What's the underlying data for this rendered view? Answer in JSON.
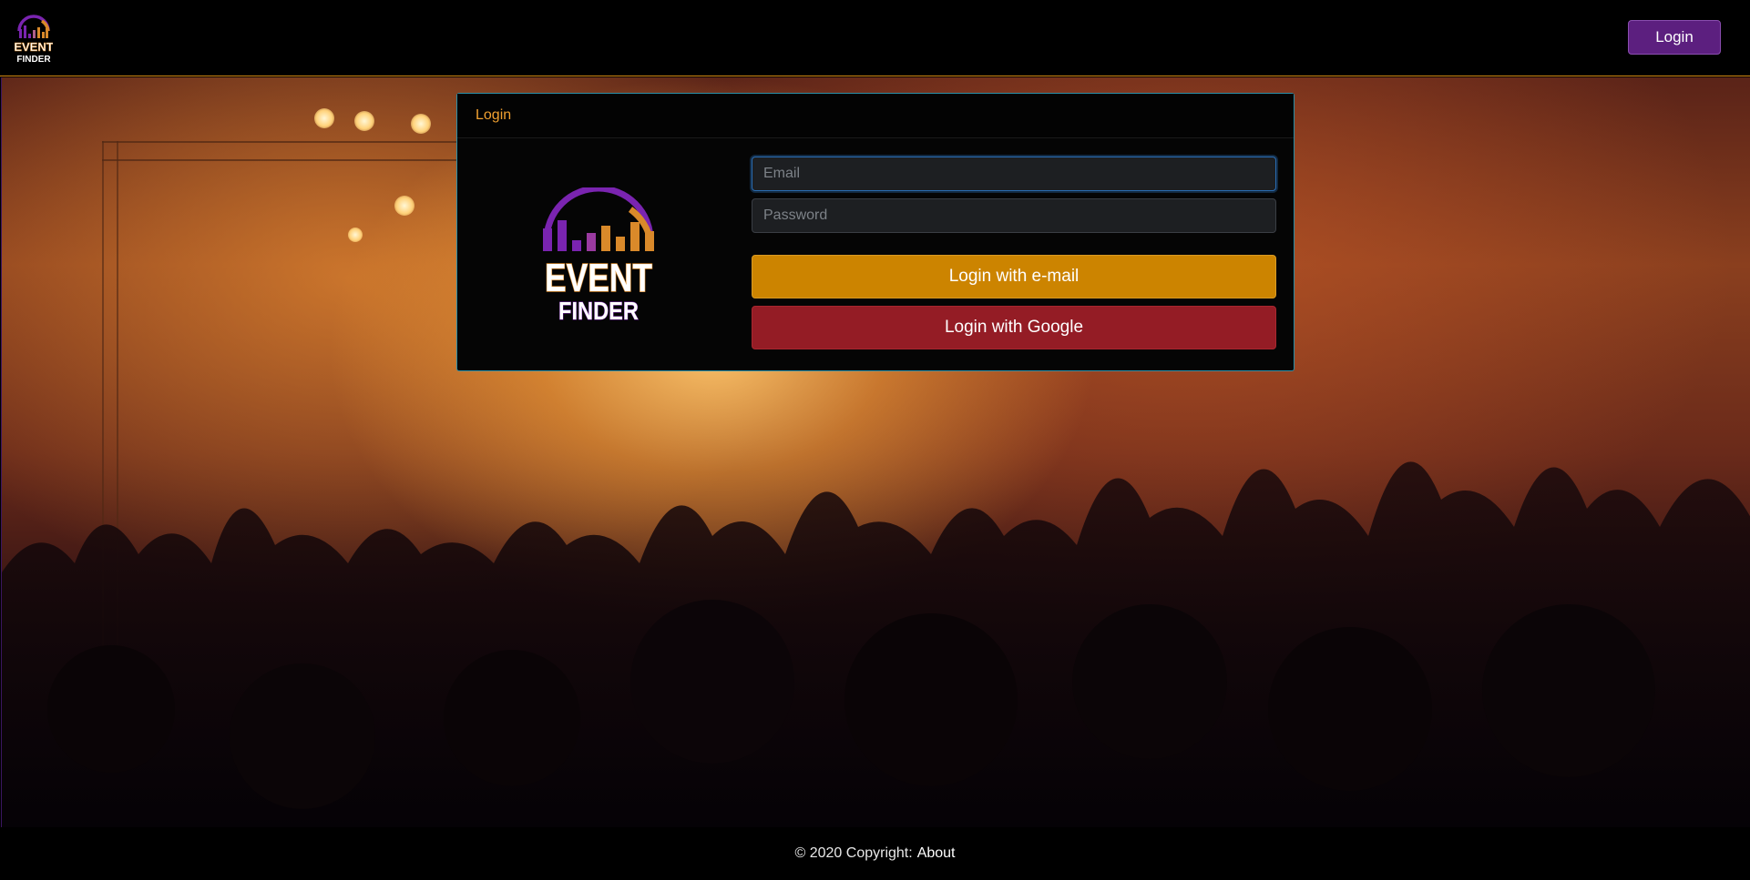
{
  "navbar": {
    "logo_text_top": "EVENT",
    "logo_text_bottom": "FINDER",
    "login_label": "Login"
  },
  "card": {
    "header_title": "Login",
    "logo_text_top": "EVENT",
    "logo_text_bottom": "FINDER",
    "email_placeholder": "Email",
    "password_placeholder": "Password",
    "email_button_label": "Login with e-mail",
    "google_button_label": "Login with Google"
  },
  "footer": {
    "copyright": "© 2020 Copyright:",
    "about_link": "About"
  },
  "colors": {
    "accent_orange": "#cc8400",
    "google_red": "#941c25",
    "brand_purple": "#5c1f7f"
  },
  "icons": {
    "nav_logo": "event-finder-logo",
    "card_logo": "event-finder-logo"
  }
}
